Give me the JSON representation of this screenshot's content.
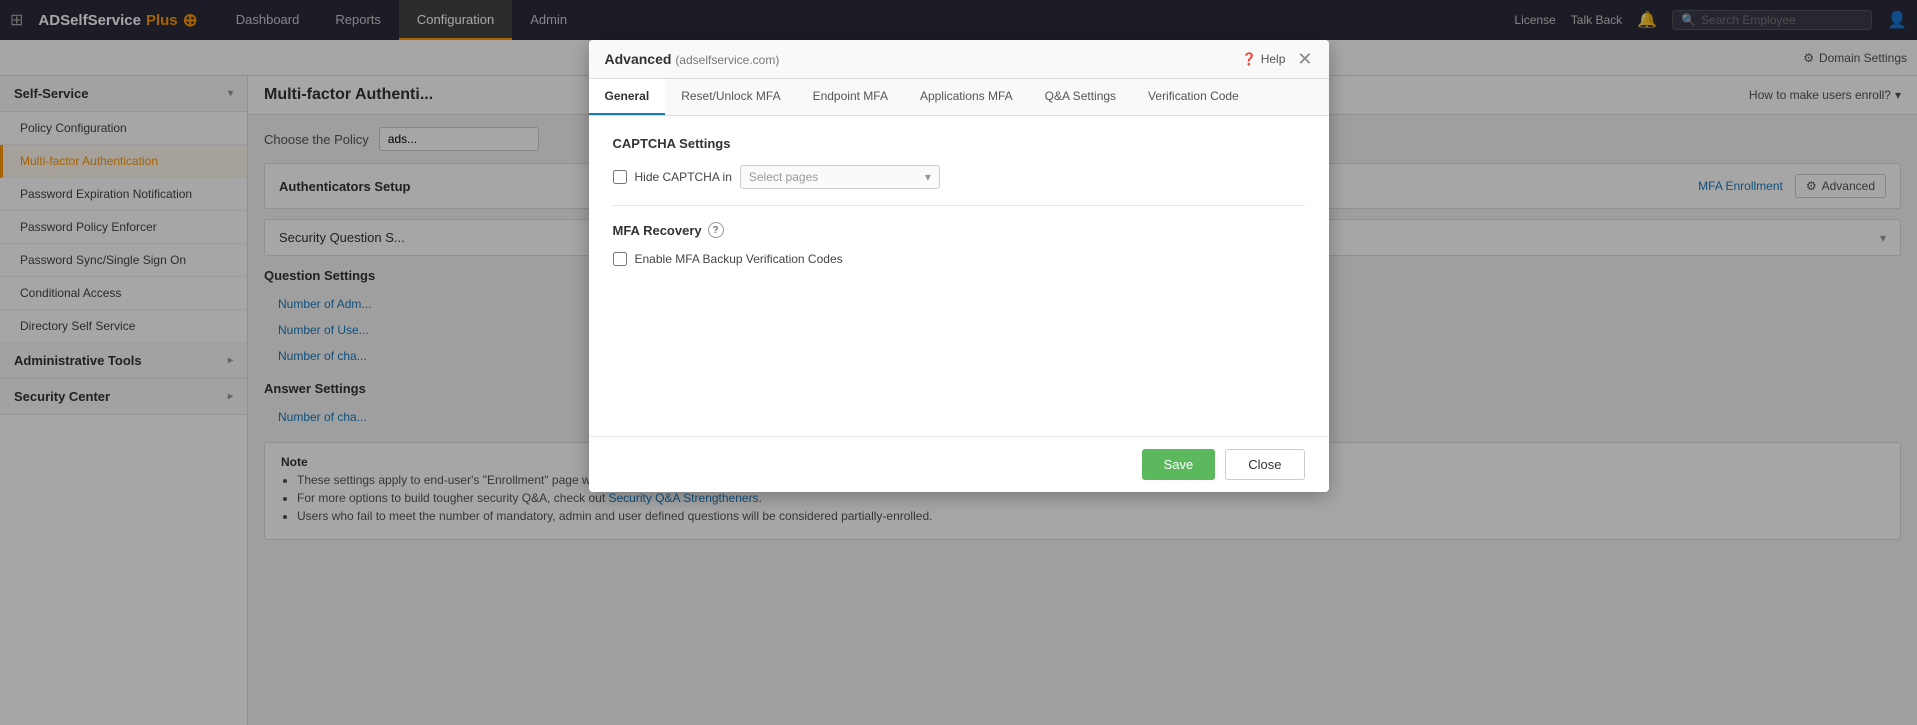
{
  "topbar": {
    "logo": "ADSelfService",
    "logo_plus": "Plus",
    "logo_symbol": "⊕",
    "grid_icon": "⊞",
    "tabs": [
      {
        "label": "Dashboard",
        "active": false
      },
      {
        "label": "Reports",
        "active": false
      },
      {
        "label": "Configuration",
        "active": true
      },
      {
        "label": "Admin",
        "active": false
      }
    ],
    "license": "License",
    "talk_back": "Talk Back",
    "search_placeholder": "Search Employee",
    "domain_settings": "Domain Settings"
  },
  "sidebar": {
    "self_service_label": "Self-Service",
    "items": [
      {
        "label": "Policy Configuration",
        "active": false
      },
      {
        "label": "Multi-factor Authentication",
        "active": true
      },
      {
        "label": "Password Expiration Notification",
        "active": false
      },
      {
        "label": "Password Policy Enforcer",
        "active": false
      },
      {
        "label": "Password Sync/Single Sign On",
        "active": false
      },
      {
        "label": "Conditional Access",
        "active": false
      },
      {
        "label": "Directory Self Service",
        "active": false
      }
    ],
    "admin_tools_label": "Administrative Tools",
    "security_center_label": "Security Center"
  },
  "main": {
    "page_title": "Multi-factor Authenti...",
    "choose_policy_label": "Choose the Policy",
    "policy_value": "ads...",
    "setup_bar_title": "Authenticators Setup",
    "mfa_enrollment": "MFA Enrollment",
    "advanced_btn": "Advanced",
    "question_row": "Security Question S...",
    "question_settings_title": "Question Settings",
    "number_adm_label": "Number of Adm...",
    "number_user_label": "Number of Use...",
    "number_char_label": "Number of cha...",
    "answer_settings_title": "Answer Settings",
    "answer_char_label": "Number of cha...",
    "how_to_link": "How to make users enroll?",
    "note_title": "Note",
    "note_items": [
      "These settings apply to end-user's \"Enrollment\" page where he configures security Q&A.",
      "For more options to build tougher security Q&A, check out Security Q&A Strengtheners.",
      "Users who fail to meet the number of mandatory, admin and user defined questions will be considered partially-enrolled."
    ],
    "note_link_text": "Security Q&A Strengtheners"
  },
  "modal": {
    "title": "Advanced",
    "subdomain": "(adselfservice.com)",
    "help_label": "Help",
    "tabs": [
      {
        "label": "General",
        "active": true
      },
      {
        "label": "Reset/Unlock MFA",
        "active": false
      },
      {
        "label": "Endpoint MFA",
        "active": false
      },
      {
        "label": "Applications MFA",
        "active": false
      },
      {
        "label": "Q&A Settings",
        "active": false
      },
      {
        "label": "Verification Code",
        "active": false
      }
    ],
    "captcha_section": "CAPTCHA Settings",
    "hide_captcha_label": "Hide CAPTCHA in",
    "select_pages_placeholder": "Select pages",
    "mfa_recovery_section": "MFA Recovery",
    "enable_backup_label": "Enable MFA Backup Verification Codes",
    "save_btn": "Save",
    "close_btn": "Close"
  }
}
